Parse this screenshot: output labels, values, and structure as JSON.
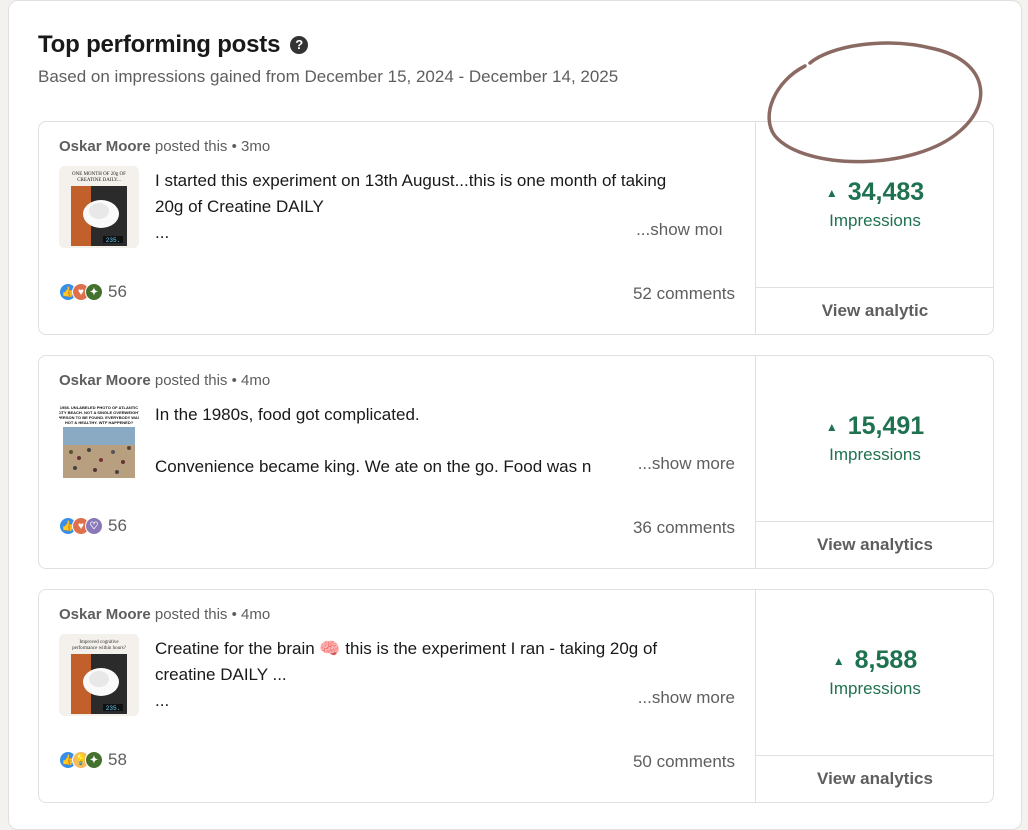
{
  "header": {
    "title": "Top performing posts",
    "help_icon": "?",
    "subtitle": "Based on impressions gained from December 15, 2024 - December 14, 2025"
  },
  "posts": [
    {
      "author": "Oskar Moore",
      "posted_label": " posted this • 3mo",
      "text_line1": "I started this experiment on 13th August...this is one month of taking",
      "text_line2": "20g of Creatine DAILY",
      "text_line3": "...",
      "show_more": "...show moı",
      "thumb_caption": "ONE MONTH OF 20g OF CREATINE DAILY...",
      "thumb_scale_reading": "235.",
      "reactions": [
        "like",
        "love",
        "celebrate"
      ],
      "reaction_count": "56",
      "comments": "52 comments",
      "impressions": "34,483",
      "impressions_label": "Impressions",
      "view_analytics": "View analytic"
    },
    {
      "author": "Oskar Moore",
      "posted_label": " posted this • 4mo",
      "text_line1": "In the 1980s, food got complicated.",
      "text_line2": "",
      "text_line3": "Convenience became king. We ate on the go. Food was n",
      "show_more": "...show more",
      "thumb_caption": "1958. UNLABELED PHOTO OF ATLANTIC CITY BEACH. NOT A SINGLE OVERWEIGHT PERSON TO BE FOUND. EVERYBODY WAS HOT & HEALTHY. WTF HAPPENED?",
      "thumb_scale_reading": "",
      "reactions": [
        "like",
        "love",
        "support"
      ],
      "reaction_count": "56",
      "comments": "36 comments",
      "impressions": "15,491",
      "impressions_label": "Impressions",
      "view_analytics": "View analytics"
    },
    {
      "author": "Oskar Moore",
      "posted_label": " posted this • 4mo",
      "text_line1": "Creatine for the brain 🧠 this is the experiment I ran - taking 20g of",
      "text_line2": "creatine DAILY ...",
      "text_line3": "...",
      "show_more": "...show more",
      "thumb_caption": "Improved cognitive performance within hours?",
      "thumb_scale_reading": "235.",
      "reactions": [
        "like",
        "insight",
        "celebrate"
      ],
      "reaction_count": "58",
      "comments": "50 comments",
      "impressions": "8,588",
      "impressions_label": "Impressions",
      "view_analytics": "View analytics"
    }
  ],
  "colors": {
    "impressions_green": "#1f7250",
    "annotation_circle": "#8b6a63"
  }
}
